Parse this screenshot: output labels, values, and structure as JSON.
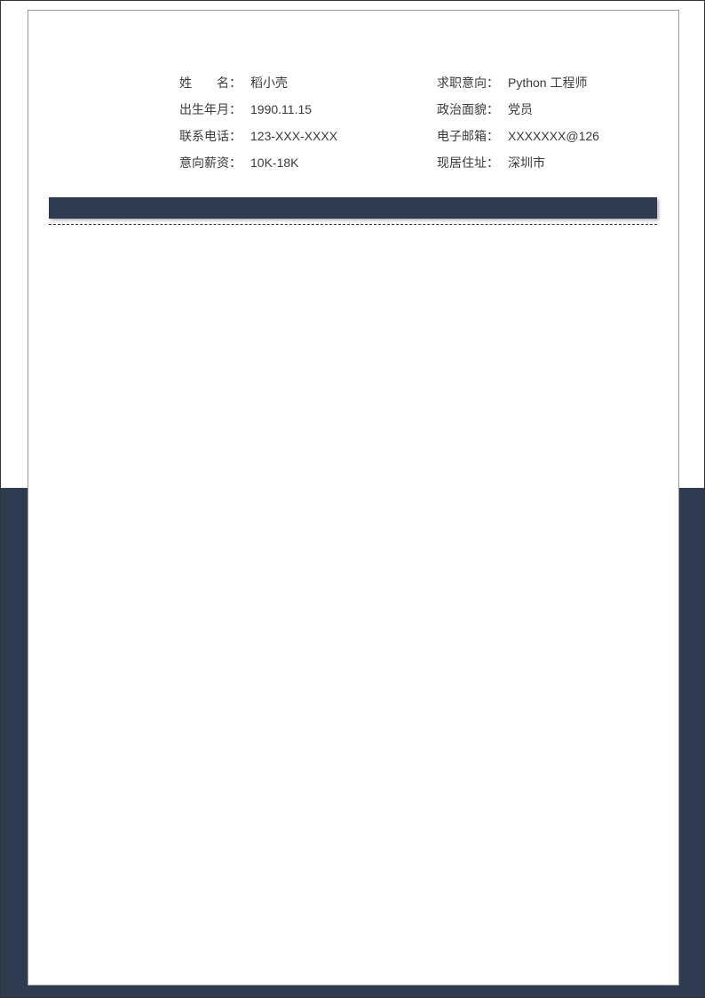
{
  "info": {
    "name_label": "姓　　名：",
    "name_value": "稻小壳",
    "job_label": "求职意向：",
    "job_value": "Python 工程师",
    "birth_label": "出生年月：",
    "birth_value": "1990.11.15",
    "political_label": "政治面貌：",
    "political_value": "党员",
    "phone_label": "联系电话：",
    "phone_value": "123-XXX-XXXX",
    "email_label": "电子邮箱：",
    "email_value": "XXXXXXX@126",
    "salary_label": "意向薪资：",
    "salary_value": "10K-18K",
    "address_label": "现居住址：",
    "address_value": "深圳市"
  },
  "colors": {
    "accent": "#2e3b50"
  }
}
